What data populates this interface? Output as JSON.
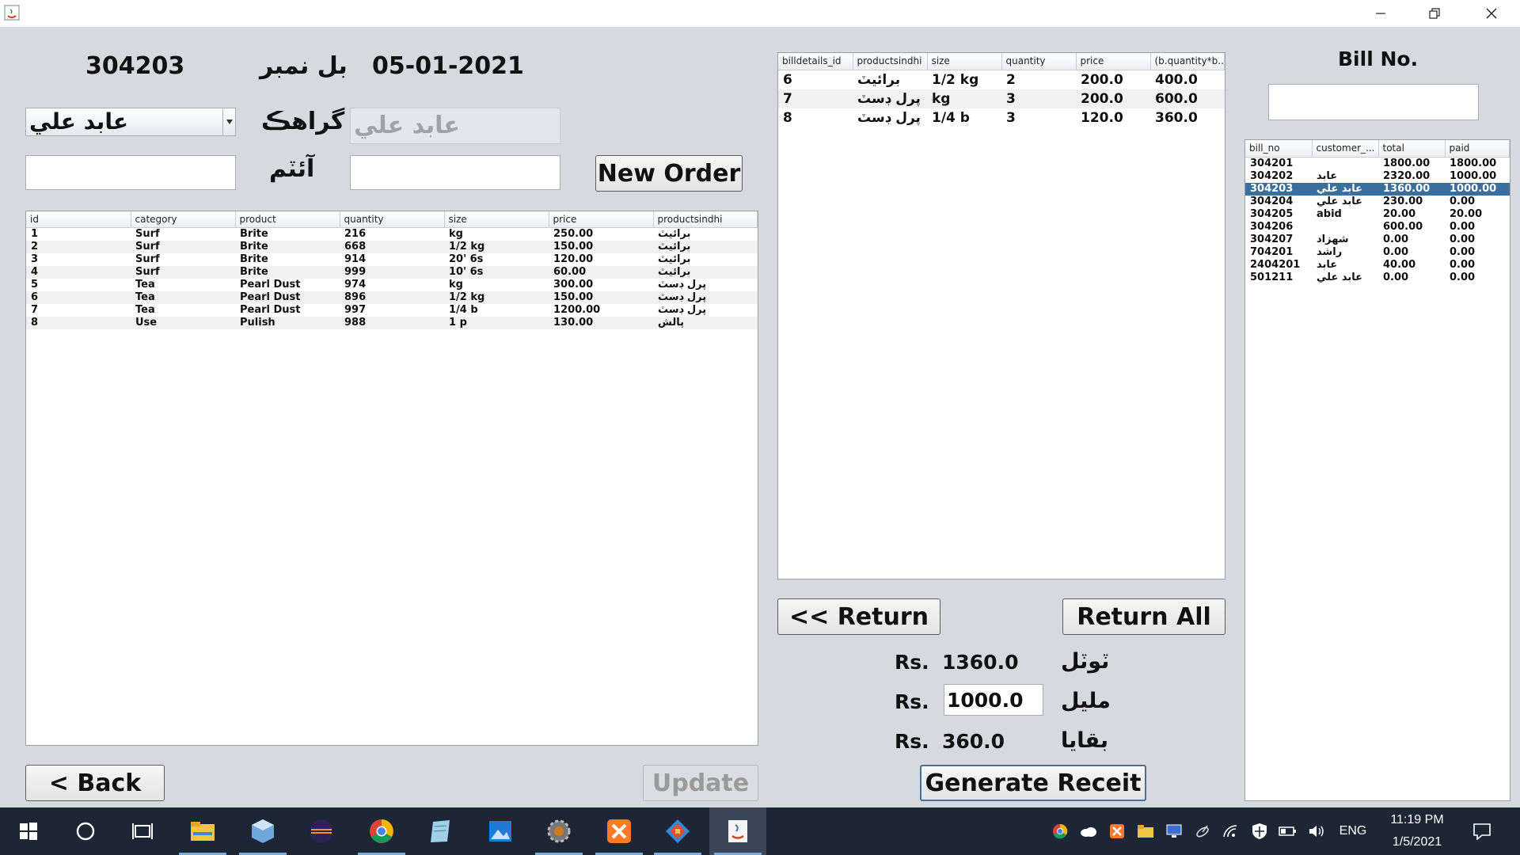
{
  "header": {
    "bill_no_value": "304203",
    "bill_no_label": "بل نمبر",
    "date": "05-01-2021"
  },
  "customer": {
    "selected": "عابد علي",
    "label": "گراهڪ",
    "display": "عابد علي"
  },
  "item": {
    "label": "آئٽم",
    "left_value": "",
    "right_value": ""
  },
  "buttons": {
    "new_order": "New Order",
    "return": "<< Return",
    "return_all": "Return All",
    "back": "< Back",
    "update": "Update",
    "generate": "Generate Receit"
  },
  "bill_search": {
    "label": "Bill No.",
    "value": ""
  },
  "products_table": {
    "columns": [
      "id",
      "category",
      "product",
      "quantity",
      "size",
      "price",
      "productsindhi"
    ],
    "rows": [
      [
        "1",
        "Surf",
        "Brite",
        "216",
        "kg",
        "250.00",
        "برائيٽ"
      ],
      [
        "2",
        "Surf",
        "Brite",
        "668",
        "1/2 kg",
        "150.00",
        "برائيٽ"
      ],
      [
        "3",
        "Surf",
        "Brite",
        "914",
        "20' 6s",
        "120.00",
        "برائيٽ"
      ],
      [
        "4",
        "Surf",
        "Brite",
        "999",
        "10' 6s",
        "60.00",
        "برائيٽ"
      ],
      [
        "5",
        "Tea",
        "Pearl Dust",
        "974",
        "kg",
        "300.00",
        "پرل ڊسٽ"
      ],
      [
        "6",
        "Tea",
        "Pearl Dust",
        "896",
        "1/2 kg",
        "150.00",
        "پرل ڊسٽ"
      ],
      [
        "7",
        "Tea",
        "Pearl Dust",
        "997",
        "1/4 b",
        "1200.00",
        "پرل ڊسٽ"
      ],
      [
        "8",
        "Use",
        "Pulish",
        "988",
        "1 p",
        "130.00",
        "پالش"
      ]
    ]
  },
  "details_table": {
    "columns": [
      "billdetails_id",
      "productsindhi",
      "size",
      "quantity",
      "price",
      "(b.quantity*b...."
    ],
    "rows": [
      [
        "6",
        "برائيٽ",
        "1/2 kg",
        "2",
        "200.0",
        "400.0"
      ],
      [
        "7",
        "پرل ڊسٽ",
        "kg",
        "3",
        "200.0",
        "600.0"
      ],
      [
        "8",
        "پرل ڊسٽ",
        "1/4 b",
        "3",
        "120.0",
        "360.0"
      ]
    ]
  },
  "bills_table": {
    "columns": [
      "bill_no",
      "customer_...",
      "total",
      "paid"
    ],
    "selected_index": 2,
    "rows": [
      [
        "304201",
        "",
        "1800.00",
        "1800.00"
      ],
      [
        "304202",
        "عابد",
        "2320.00",
        "1000.00"
      ],
      [
        "304203",
        "عابد علي",
        "1360.00",
        "1000.00"
      ],
      [
        "304204",
        "عابد علي",
        "230.00",
        "0.00"
      ],
      [
        "304205",
        "abid",
        "20.00",
        "20.00"
      ],
      [
        "304206",
        "",
        "600.00",
        "0.00"
      ],
      [
        "304207",
        "شهزاد",
        "0.00",
        "0.00"
      ],
      [
        "704201",
        "راشد",
        "0.00",
        "0.00"
      ],
      [
        "2404201",
        "عابد",
        "40.00",
        "0.00"
      ],
      [
        "501211",
        "عابد علي",
        "0.00",
        "0.00"
      ]
    ]
  },
  "totals": {
    "currency": "Rs.",
    "total_label": "ٽوٽل",
    "total_value": "1360.0",
    "paid_label": "مليل",
    "paid_value": "1000.0",
    "balance_label": "بقايا",
    "balance_value": "360.0"
  },
  "taskbar": {
    "language": "ENG",
    "time": "11:19 PM",
    "date": "1/5/2021"
  }
}
